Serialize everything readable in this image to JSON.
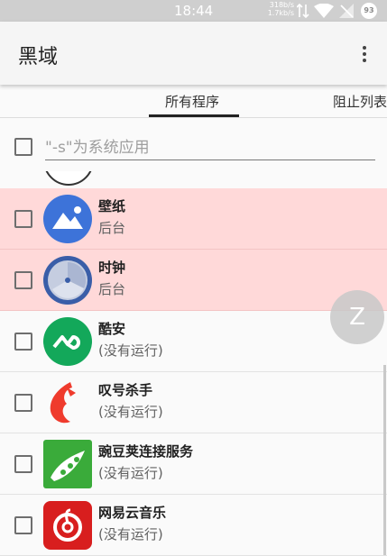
{
  "status_bar": {
    "time": "18:44",
    "upload_speed": "318b/s",
    "download_speed": "1.7kb/s",
    "battery": "93"
  },
  "app_bar": {
    "title": "黑域",
    "menu_icon": "more-vert-icon"
  },
  "tabs": [
    {
      "label": "所有程序",
      "selected": true
    },
    {
      "label": "阻止列表",
      "selected": false
    }
  ],
  "system_filter": {
    "checked": false,
    "label": "\"-s\"为系统应用"
  },
  "apps": [
    {
      "name": "壁纸",
      "status": "后台",
      "blocked": true,
      "checked": false,
      "icon": "wallpaper-icon"
    },
    {
      "name": "时钟",
      "status": "后台",
      "blocked": true,
      "checked": false,
      "icon": "clock-icon"
    },
    {
      "name": "酷安",
      "status": "(没有运行)",
      "blocked": false,
      "checked": false,
      "icon": "coolapk-icon"
    },
    {
      "name": "叹号杀手",
      "status": "(没有运行)",
      "blocked": false,
      "checked": false,
      "icon": "exclamation-killer-icon"
    },
    {
      "name": "豌豆荚连接服务",
      "status": "(没有运行)",
      "blocked": false,
      "checked": false,
      "icon": "wandoujia-icon"
    },
    {
      "name": "网易云音乐",
      "status": "(没有运行)",
      "blocked": false,
      "checked": false,
      "icon": "netease-music-icon"
    }
  ],
  "fab": {
    "label": "Z"
  },
  "colors": {
    "blocked_row": "#ffd9d9",
    "coolapk_green": "#13a85a",
    "netease_red": "#d81e1e",
    "wandoujia_green": "#3aab3a"
  }
}
